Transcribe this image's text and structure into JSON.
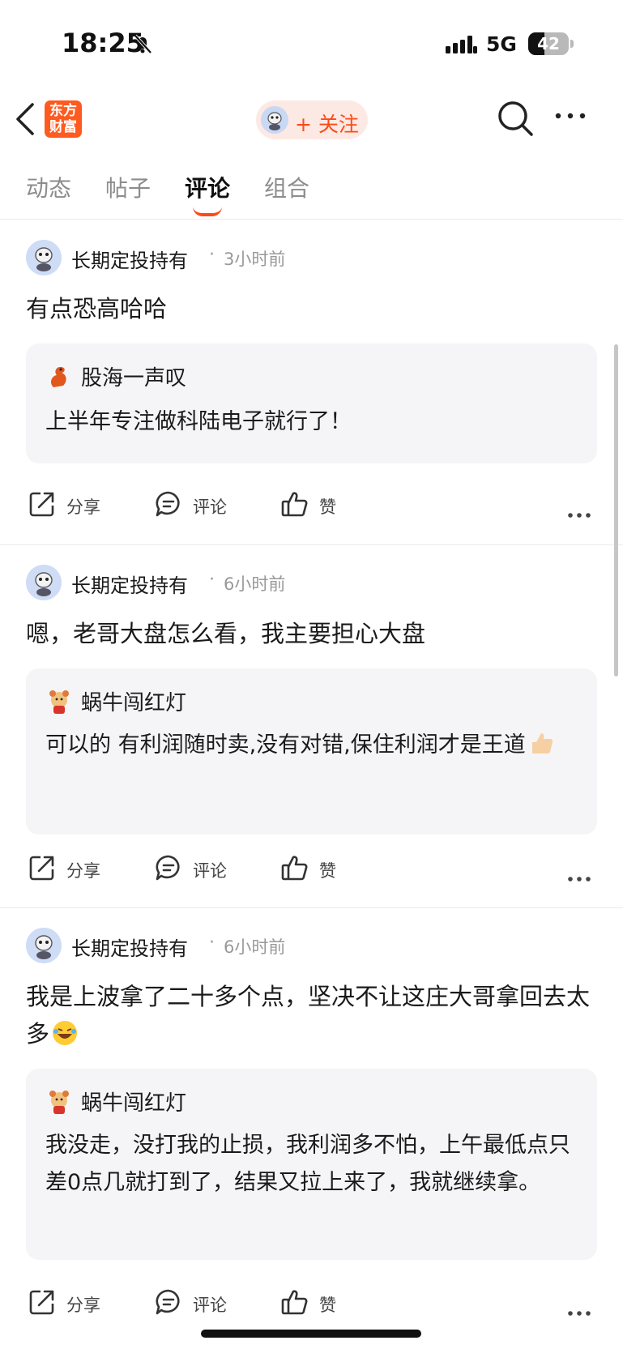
{
  "status_bar": {
    "time": "18:25",
    "network": "5G",
    "battery": "42"
  },
  "nav": {
    "logo_text": "东方财富",
    "follow_label": "+ 关注"
  },
  "tabs": [
    "动态",
    "帖子",
    "评论",
    "组合"
  ],
  "active_tab": "评论",
  "posts": [
    {
      "user": "长期定投持有",
      "time": "3小时前",
      "content": "有点恐高哈哈",
      "quote": {
        "user": "股海一声叹",
        "text": "上半年专注做科陆电子就行了！"
      }
    },
    {
      "user": "长期定投持有",
      "time": "6小时前",
      "content": "嗯，老哥大盘怎么看，我主要担心大盘",
      "quote": {
        "user": "蜗牛闯红灯",
        "text": "可以的 有利润随时卖,没有对错,保住利润才是王道"
      }
    },
    {
      "user": "长期定投持有",
      "time": "6小时前",
      "content": "我是上波拿了二十多个点，坚决不让这庄大哥拿回去太多",
      "quote": {
        "user": "蜗牛闯红灯",
        "text": "我没走，没打我的止损，我利润多不怕，上午最低点只差0点几就打到了，结果又拉上来了，我就继续拿。"
      }
    }
  ],
  "actions": {
    "share": "分享",
    "comment": "评论",
    "like": "赞"
  },
  "colors": {
    "accent": "#ff4a17",
    "quote_bg": "#f5f5f7",
    "secondary_text": "#999999"
  }
}
